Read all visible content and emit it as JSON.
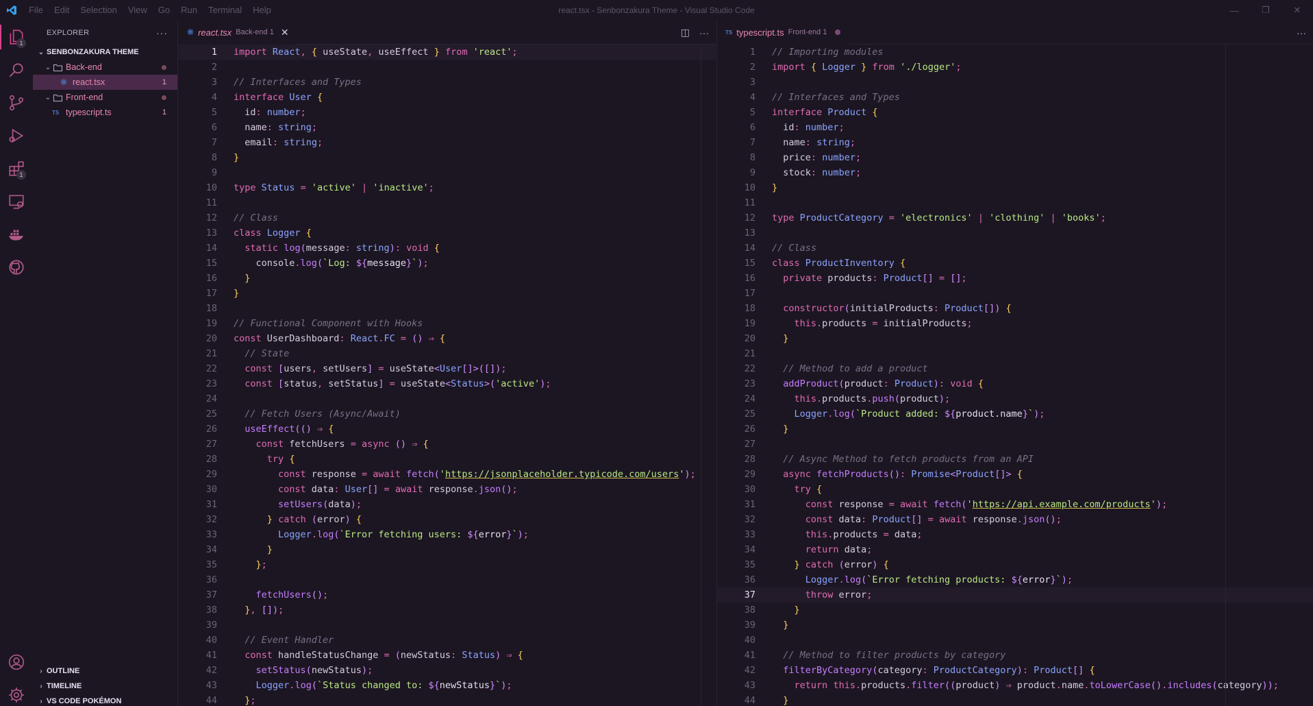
{
  "titlebar": {
    "menu": [
      "File",
      "Edit",
      "Selection",
      "View",
      "Go",
      "Run",
      "Terminal",
      "Help"
    ],
    "title": "react.tsx - Senbonzakura Theme - Visual Studio Code"
  },
  "activitybar": {
    "items": [
      {
        "icon": "files-icon",
        "badge": "1"
      },
      {
        "icon": "search-icon",
        "badge": ""
      },
      {
        "icon": "source-control-icon",
        "badge": ""
      },
      {
        "icon": "run-debug-icon",
        "badge": ""
      },
      {
        "icon": "extensions-icon",
        "badge": "1"
      },
      {
        "icon": "remote-explorer-icon",
        "badge": ""
      },
      {
        "icon": "docker-icon",
        "badge": ""
      },
      {
        "icon": "github-icon",
        "badge": ""
      }
    ],
    "bottom": [
      {
        "icon": "account-icon"
      },
      {
        "icon": "settings-gear-icon"
      }
    ]
  },
  "sidebar": {
    "title": "EXPLORER",
    "section": "SENBONZAKURA THEME",
    "tree": [
      {
        "label": "Back-end",
        "type": "folder"
      },
      {
        "label": "react.tsx",
        "type": "file",
        "count": "1"
      },
      {
        "label": "Front-end",
        "type": "folder"
      },
      {
        "label": "typescript.ts",
        "type": "file",
        "count": "1",
        "icon_text": "TS"
      }
    ],
    "bottom_sections": [
      "OUTLINE",
      "TIMELINE",
      "VS CODE POKÉMON"
    ]
  },
  "editor_left": {
    "tab": {
      "name": "react.tsx",
      "desc": "Back-end 1"
    },
    "current_line": 1,
    "lines": [
      "import React, { useState, useEffect } from 'react';",
      "",
      "// Interfaces and Types",
      "interface User {",
      "  id: number;",
      "  name: string;",
      "  email: string;",
      "}",
      "",
      "type Status = 'active' | 'inactive';",
      "",
      "// Class",
      "class Logger {",
      "  static log(message: string): void {",
      "    console.log(`Log: ${message}`);",
      "  }",
      "}",
      "",
      "// Functional Component with Hooks",
      "const UserDashboard: React.FC = () => {",
      "  // State",
      "  const [users, setUsers] = useState<User[]>([]);",
      "  const [status, setStatus] = useState<Status>('active');",
      "",
      "  // Fetch Users (Async/Await)",
      "  useEffect(() => {",
      "    const fetchUsers = async () => {",
      "      try {",
      "        const response = await fetch('https://jsonplaceholder.typicode.com/users');",
      "        const data: User[] = await response.json();",
      "        setUsers(data);",
      "      } catch (error) {",
      "        Logger.log(`Error fetching users: ${error}`);",
      "      }",
      "    };",
      "",
      "    fetchUsers();",
      "  }, []);",
      "",
      "  // Event Handler",
      "  const handleStatusChange = (newStatus: Status) => {",
      "    setStatus(newStatus);",
      "    Logger.log(`Status changed to: ${newStatus}`);",
      "  };"
    ]
  },
  "editor_right": {
    "tab": {
      "name": "typescript.ts",
      "desc": "Front-end 1",
      "icon_text": "TS"
    },
    "current_line": 37,
    "lines": [
      "// Importing modules",
      "import { Logger } from './logger';",
      "",
      "// Interfaces and Types",
      "interface Product {",
      "  id: number;",
      "  name: string;",
      "  price: number;",
      "  stock: number;",
      "}",
      "",
      "type ProductCategory = 'electronics' | 'clothing' | 'books';",
      "",
      "// Class",
      "class ProductInventory {",
      "  private products: Product[] = [];",
      "",
      "  constructor(initialProducts: Product[]) {",
      "    this.products = initialProducts;",
      "  }",
      "",
      "  // Method to add a product",
      "  addProduct(product: Product): void {",
      "    this.products.push(product);",
      "    Logger.log(`Product added: ${product.name}`);",
      "  }",
      "",
      "  // Async Method to fetch products from an API",
      "  async fetchProducts(): Promise<Product[]> {",
      "    try {",
      "      const response = await fetch('https://api.example.com/products');",
      "      const data: Product[] = await response.json();",
      "      this.products = data;",
      "      return data;",
      "    } catch (error) {",
      "      Logger.log(`Error fetching products: ${error}`);",
      "      throw error;",
      "    }",
      "  }",
      "",
      "  // Method to filter products by category",
      "  filterByCategory(category: ProductCategory): Product[] {",
      "    return this.products.filter((product) => product.name.toLowerCase().includes(category));",
      "  }"
    ]
  },
  "colors": {
    "background": "#1c1622",
    "accent": "#d4438a",
    "keyword": "#e06cb4",
    "type": "#8aa4ff",
    "string": "#b9e884",
    "comment": "#7a6e86",
    "function": "#c67dff"
  }
}
